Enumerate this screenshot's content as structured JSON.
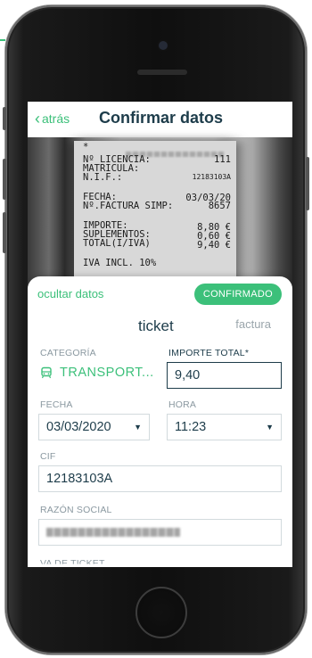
{
  "nav": {
    "back_label": "atrás",
    "title": "Confirmar datos"
  },
  "receipt": {
    "asterisk": "*",
    "licencia_label": "Nº LICENCIA:",
    "licencia_value": "111",
    "matricula_label": "MATRICULA:",
    "nif_label": "N.I.F.:",
    "nif_value": "12183103A",
    "fecha_label": "FECHA:",
    "fecha_value": "03/03/20",
    "factura_label": "Nº.FACTURA SIMP:",
    "factura_value": "8657",
    "importe_label": "IMPORTE:",
    "importe_value": "8,80 €",
    "suplementos_label": "SUPLEMENTOS:",
    "suplementos_value": "0,60 €",
    "total_label": "TOTAL(I/IVA)",
    "total_value": "9,40 €",
    "iva_line": "IVA INCL. 10%"
  },
  "sheet": {
    "hide_label": "ocultar datos",
    "status_badge": "CONFIRMADO",
    "type_ticket": "ticket",
    "type_factura": "factura",
    "category_label": "CATEGORÍA",
    "category_value": "TRANSPORT...",
    "total_label": "IMPORTE TOTAL*",
    "total_value": "9,40",
    "date_label": "FECHA",
    "date_value": "03/03/2020",
    "time_label": "HORA",
    "time_value": "11:23",
    "cif_label": "CIF",
    "cif_value": "12183103A",
    "razon_label": "RAZÓN SOCIAL",
    "cut_label": "VA DE TICKET"
  },
  "colors": {
    "accent": "#3cc07a",
    "text_dark": "#1d3c4a",
    "label_gray": "#8a98a0"
  },
  "icons": {
    "back": "chevron-left-icon",
    "category": "bus-icon",
    "dropdown": "caret-down-icon"
  }
}
